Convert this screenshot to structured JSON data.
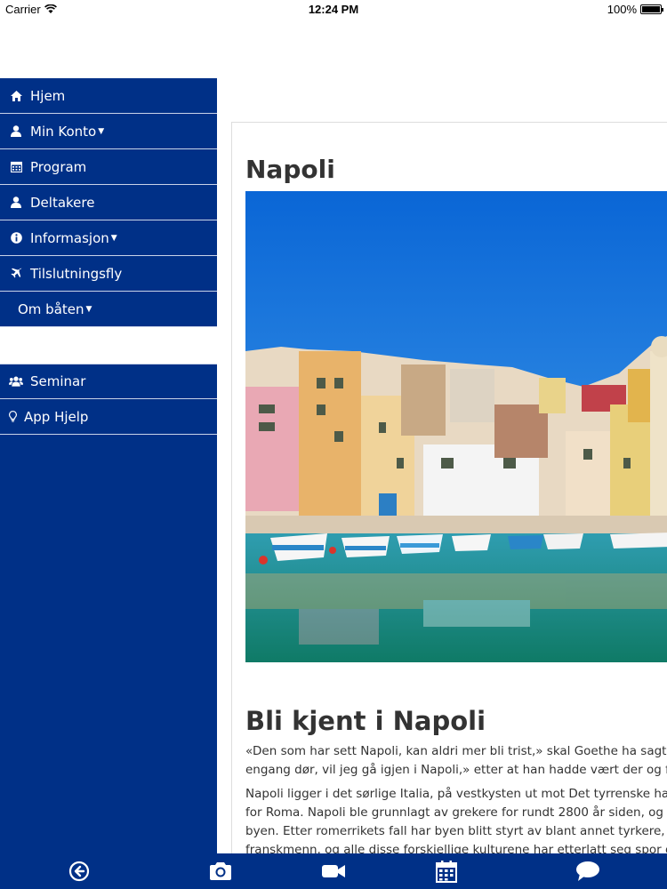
{
  "status_bar": {
    "carrier": "Carrier",
    "time": "12:24 PM",
    "battery": "100%"
  },
  "sidebar": {
    "items": [
      {
        "label": "Hjem",
        "icon": "home-icon"
      },
      {
        "label": "Min Konto",
        "icon": "user-icon",
        "dropdown": true
      },
      {
        "label": "Program",
        "icon": "calendar-icon"
      },
      {
        "label": "Deltakere",
        "icon": "user-icon"
      },
      {
        "label": "Informasjon",
        "icon": "info-icon",
        "dropdown": true
      },
      {
        "label": "Tilslutningsfly",
        "icon": "plane-icon"
      },
      {
        "label": "Om båten",
        "icon": "",
        "dropdown": true
      }
    ],
    "secondary_items": [
      {
        "label": "Seminar",
        "icon": "users-icon"
      },
      {
        "label": "App Hjelp",
        "icon": "lightbulb-icon"
      }
    ]
  },
  "content": {
    "title": "Napoli",
    "section_title": "Bli kjent i Napoli",
    "paragraph1": [
      "«Den som har sett Napoli, kan aldri mer bli trist,» skal Goethe ha sagt. Henr",
      "engang dør, vil jeg gå igjen i Napoli,» etter at han hadde vært der og fullført"
    ],
    "paragraph2": [
      "Napoli ligger i det sørlige Italia, på vestkysten ut mot Det tyrrenske hav i Mi",
      "for Roma. Napoli ble grunnlagt av grekere for rundt 2800 år siden, og gikk fi",
      "byen. Etter romerrikets fall har byen blitt styrt av blant annet tyrkere, spanjo",
      "franskmenn, og alle disse forskjellige kulturene har etterlatt seg spor du fori"
    ]
  },
  "toolbar": {
    "buttons": [
      "back-icon",
      "camera-icon",
      "video-icon",
      "calendar-icon",
      "chat-icon"
    ]
  },
  "colors": {
    "sidebar_bg": "#003087",
    "divider": "#c9d3e8",
    "sky": "#1f7fe0",
    "sea": "#1fa7a0"
  }
}
